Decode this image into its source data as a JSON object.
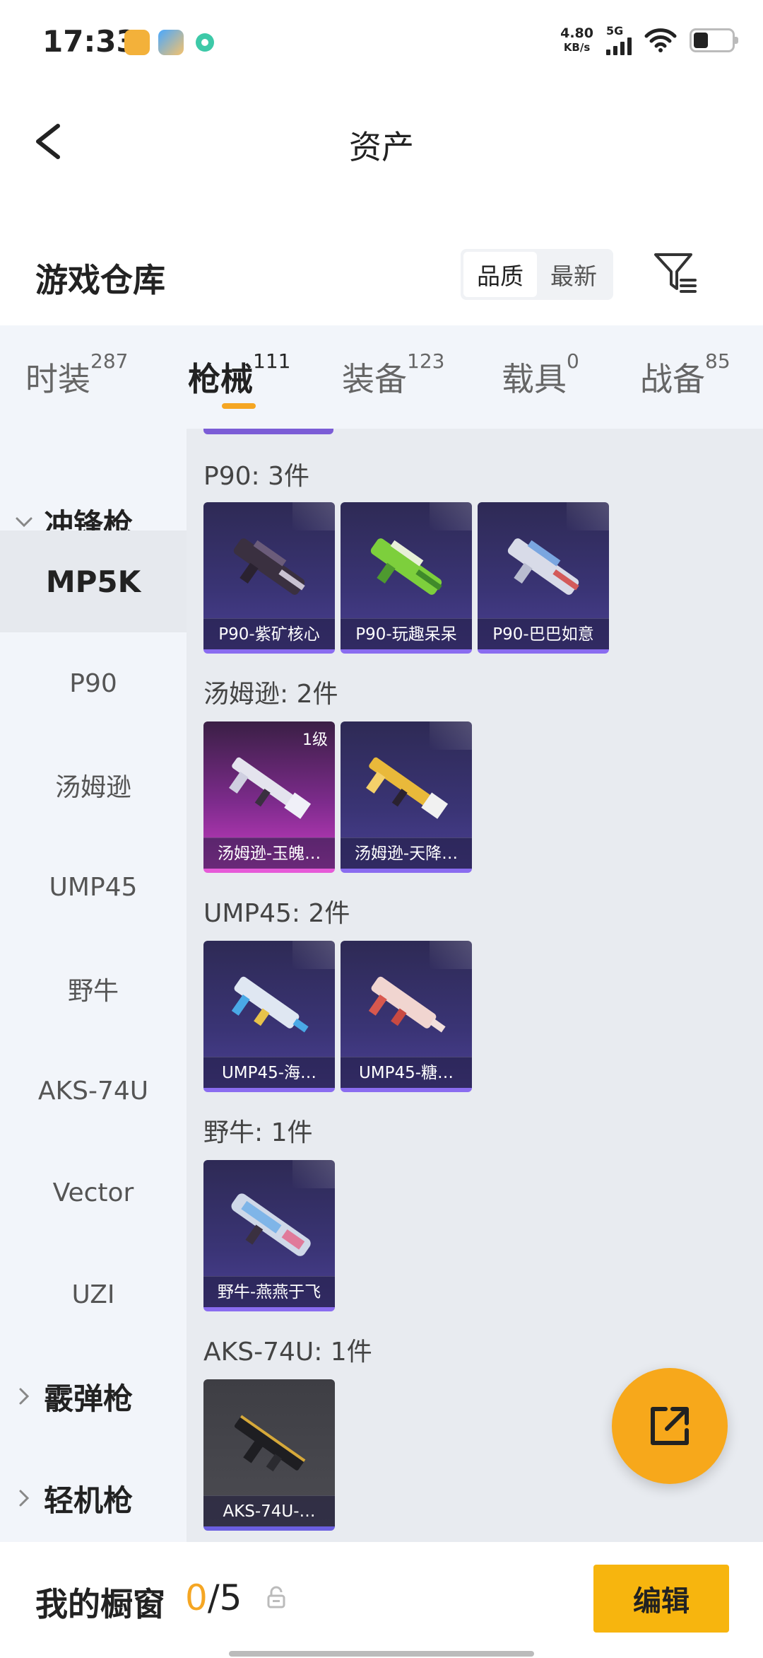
{
  "status_bar": {
    "time": "17:33",
    "speed_value": "4.80",
    "speed_unit": "KB/s",
    "network": "5G",
    "app_icons": [
      "app-icon-orange",
      "app-icon-blue",
      "app-icon-green"
    ]
  },
  "header": {
    "title": "资产"
  },
  "warehouse": {
    "title": "游戏仓库",
    "sort_options": [
      "品质",
      "最新"
    ],
    "sort_selected": "品质"
  },
  "tabs": [
    {
      "label": "时装",
      "count": "287"
    },
    {
      "label": "枪械",
      "count": "111",
      "active": true
    },
    {
      "label": "装备",
      "count": "123"
    },
    {
      "label": "载具",
      "count": "0"
    },
    {
      "label": "战备",
      "count": "85"
    }
  ],
  "sidenav": {
    "group_open": "冲锋枪",
    "items": [
      "MP5K",
      "P90",
      "汤姆逊",
      "UMP45",
      "野牛",
      "AKS-74U",
      "Vector",
      "UZI"
    ],
    "selected": "MP5K",
    "groups_closed": [
      "霰弹枪",
      "轻机枪"
    ]
  },
  "sections": [
    {
      "label": "P90: 3件",
      "items": [
        {
          "name": "P90-紫矿核心",
          "tint": "purple"
        },
        {
          "name": "P90-玩趣呆呆",
          "tint": "purple"
        },
        {
          "name": "P90-巴巴如意",
          "tint": "purple"
        }
      ]
    },
    {
      "label": "汤姆逊: 2件",
      "items": [
        {
          "name": "汤姆逊-玉魄…",
          "tint": "pink",
          "badge": "1级"
        },
        {
          "name": "汤姆逊-天降…",
          "tint": "purple"
        }
      ]
    },
    {
      "label": "UMP45: 2件",
      "items": [
        {
          "name": "UMP45-海…",
          "tint": "purple"
        },
        {
          "name": "UMP45-糖…",
          "tint": "purple"
        }
      ]
    },
    {
      "label": "野牛: 1件",
      "items": [
        {
          "name": "野牛-燕燕于飞",
          "tint": "purple"
        }
      ]
    },
    {
      "label": "AKS-74U: 1件",
      "items": [
        {
          "name": "AKS-74U-…",
          "tint": "gray"
        }
      ]
    }
  ],
  "bottom": {
    "showcase_label": "我的橱窗",
    "showcase_filled": "0",
    "showcase_total": "/5",
    "edit_label": "编辑"
  },
  "colors": {
    "accent": "#f5a623",
    "edit_button": "#f7b50e",
    "purple_card": "#3a3475",
    "pink_card": "#7d2b8c"
  }
}
